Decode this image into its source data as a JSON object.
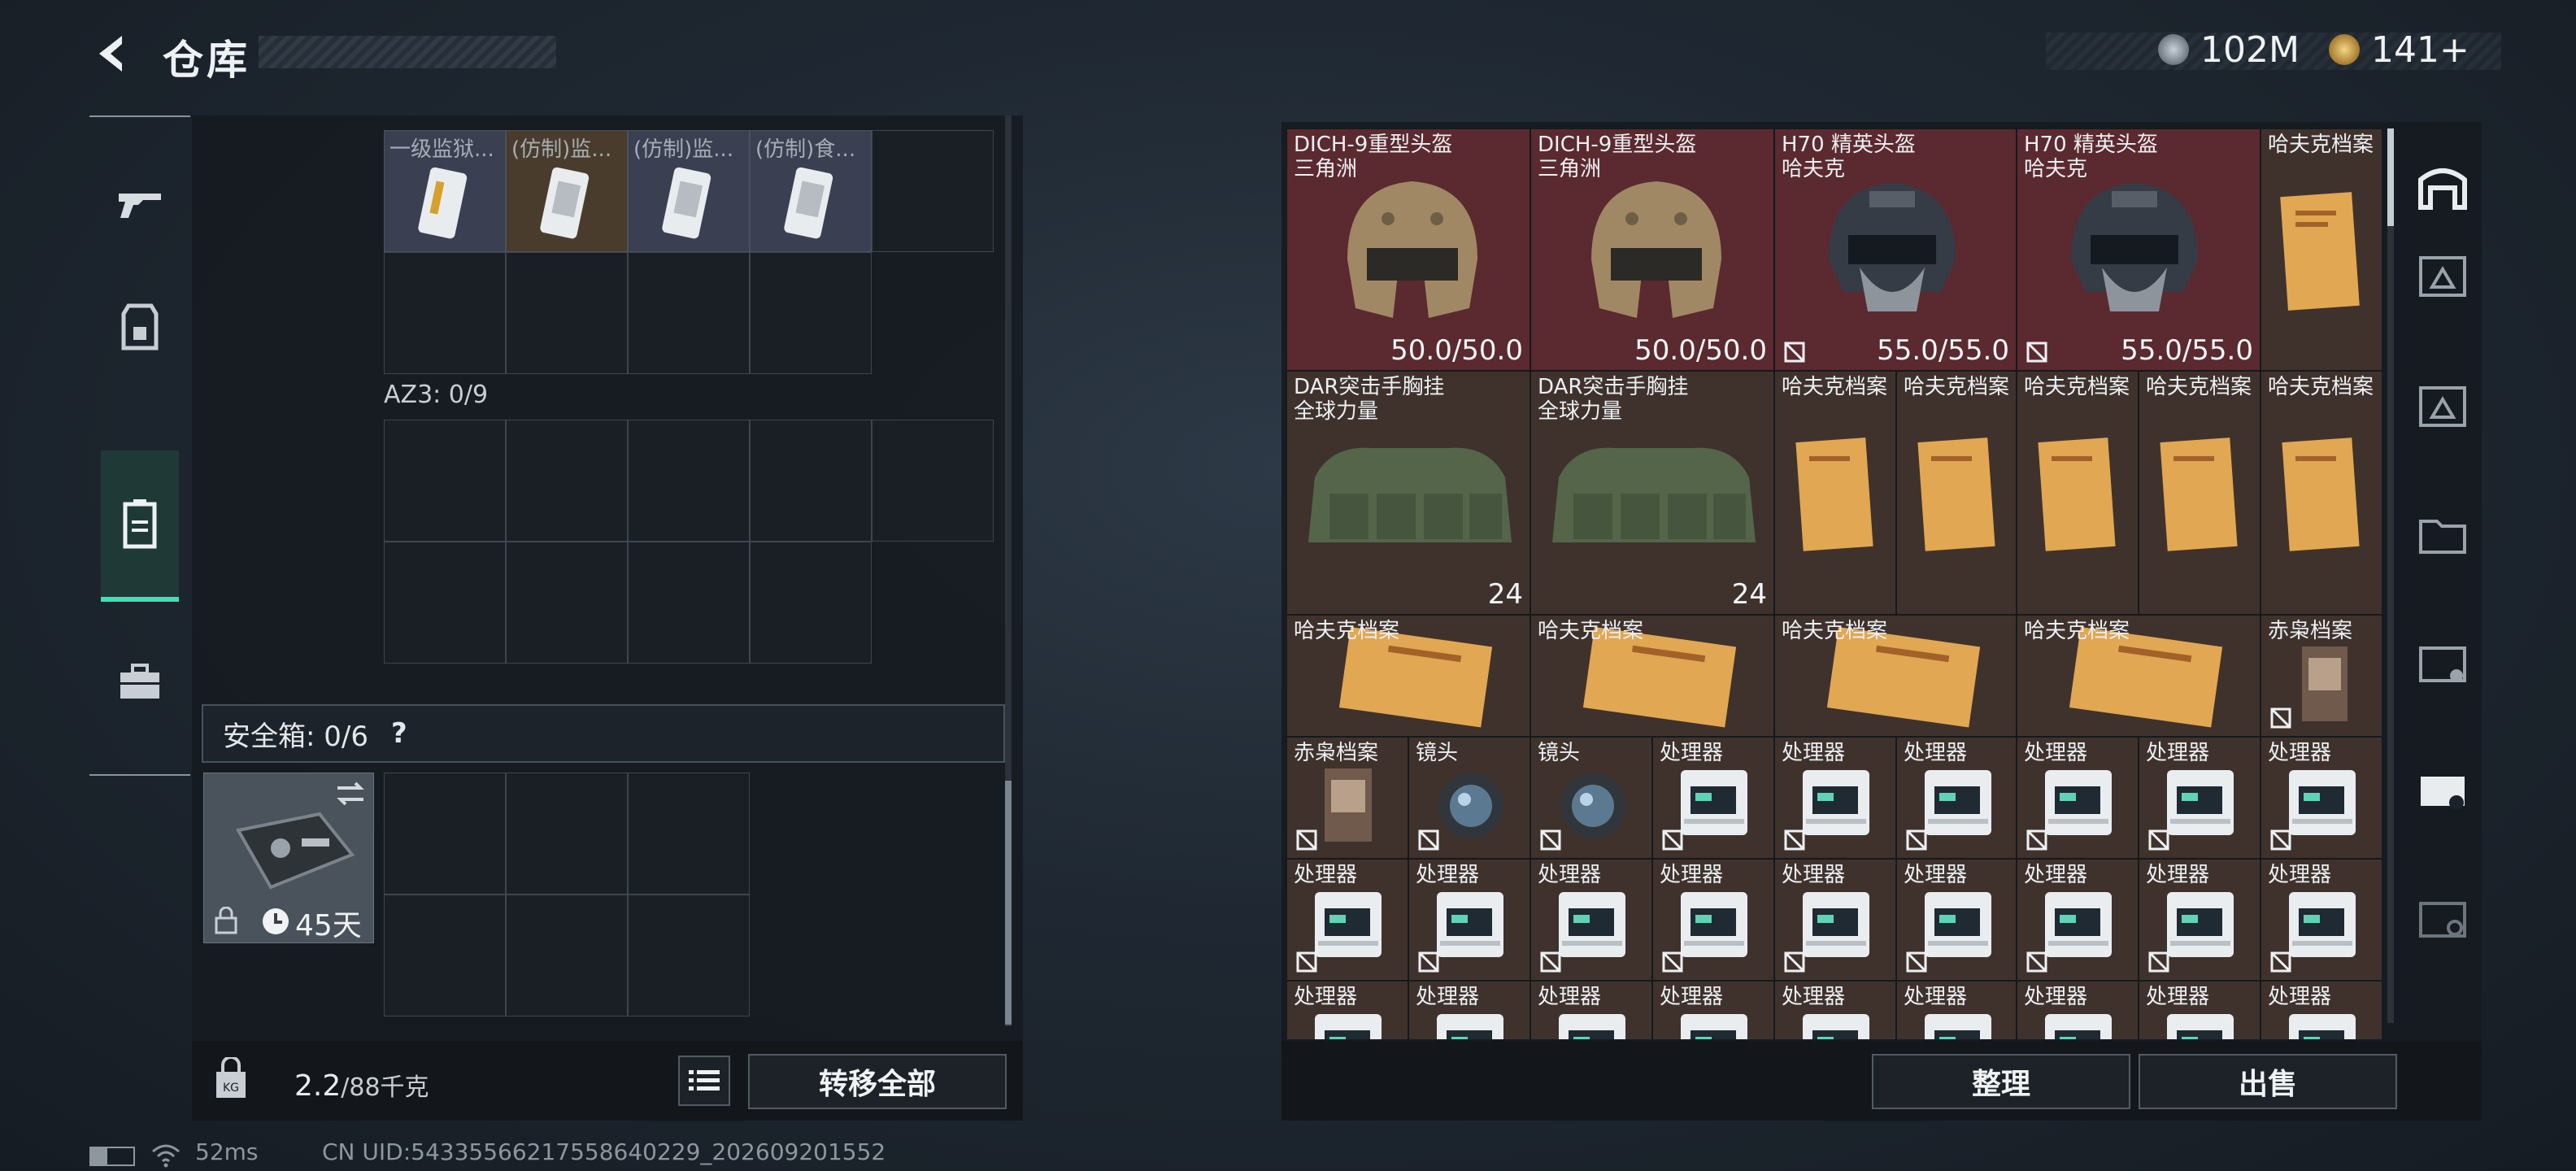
{
  "header": {
    "title": "仓库",
    "currency": [
      {
        "icon": "silver-coin-icon",
        "value": "102M"
      },
      {
        "icon": "gold-coin-icon",
        "value": "141+"
      }
    ]
  },
  "left": {
    "top_items": [
      {
        "name": "一级监狱..."
      },
      {
        "name": "(仿制)监..."
      },
      {
        "name": "(仿制)监..."
      },
      {
        "name": "(仿制)食..."
      }
    ],
    "container_label": "AZ3: 0/9",
    "safe_label": "安全箱: 0/6",
    "help": "?",
    "safe_time": "45天",
    "weight_value": "2.2",
    "weight_max": "/88千克",
    "transfer_all": "转移全部"
  },
  "right": {
    "row1": [
      {
        "name": "DICH-9重型头盔\n三角洲",
        "value": "50.0/50.0",
        "kind": "tan-helmet"
      },
      {
        "name": "DICH-9重型头盔\n三角洲",
        "value": "50.0/50.0",
        "kind": "tan-helmet"
      },
      {
        "name": "H70 精英头盔\n哈夫克",
        "value": "55.0/55.0",
        "kind": "dark-helmet"
      },
      {
        "name": "H70 精英头盔\n哈夫克",
        "value": "55.0/55.0",
        "kind": "dark-helmet"
      },
      {
        "name": "哈夫克档案",
        "value": "",
        "kind": "file"
      }
    ],
    "row2": [
      {
        "name": "DAR突击手胸挂\n全球力量",
        "value": "24"
      },
      {
        "name": "DAR突击手胸挂\n全球力量",
        "value": "24"
      }
    ],
    "file_label": "哈夫克档案",
    "owl_label": "赤枭档案",
    "lens_label": "镜头",
    "cpu_label": "处理器",
    "sort": "整理",
    "sell": "出售"
  },
  "status": {
    "ping": "52ms",
    "uid": "CN UID:54335566217558640229_202609201552"
  },
  "colors": {
    "accent": "#3ee0b4",
    "red_rarity": "#5a2a30",
    "brown_rarity": "#3f322d"
  }
}
